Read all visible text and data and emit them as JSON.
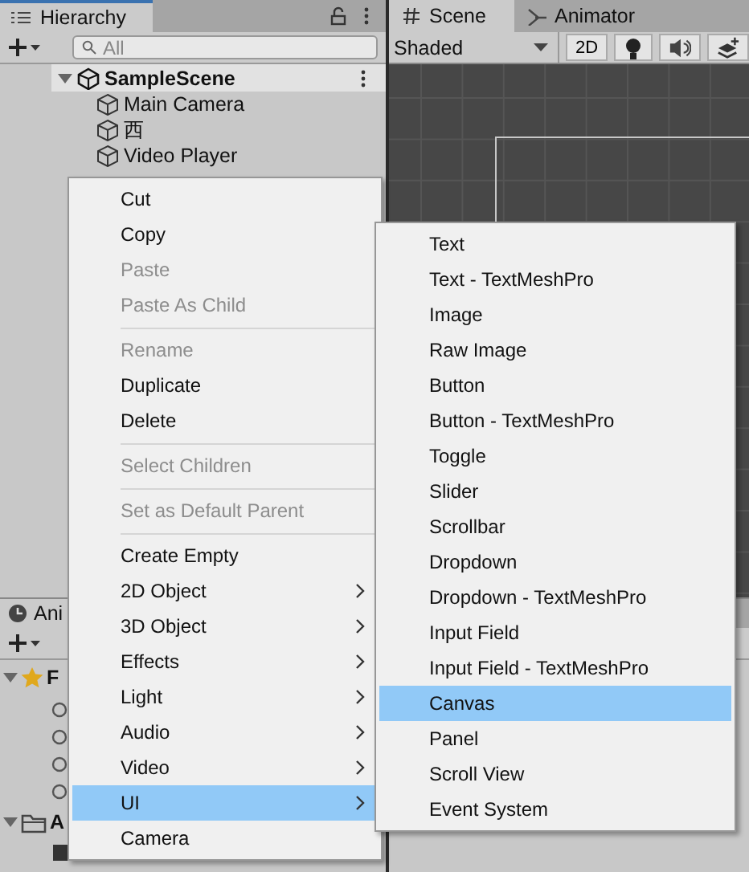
{
  "hierarchy": {
    "tab": "Hierarchy",
    "search": {
      "placeholder": "All"
    },
    "scene": {
      "name": "SampleScene",
      "expanded": true
    },
    "objects": [
      {
        "name": "Main Camera"
      },
      {
        "name": "西"
      },
      {
        "name": "Video Player"
      }
    ]
  },
  "scene_view": {
    "tabs": [
      {
        "label": "Scene",
        "selected": true,
        "kind": "grid"
      },
      {
        "label": "Animator",
        "selected": false,
        "kind": "animator"
      }
    ],
    "shading": "Shaded",
    "mode_2d": {
      "label": "2D",
      "on": false
    },
    "toggles": [
      {
        "kind": "lighting",
        "on": false
      },
      {
        "kind": "audio",
        "on": false
      },
      {
        "kind": "effects",
        "on": false
      }
    ]
  },
  "animation_panel": {
    "tab": "Ani",
    "tree": [
      {
        "label": "F",
        "kind": "favorites",
        "expanded": true
      },
      {
        "label": "A",
        "kind": "folder",
        "expanded": true
      }
    ]
  },
  "context_menu": {
    "items": [
      {
        "kind": "item",
        "label": "Cut",
        "disabled": false,
        "selected": false
      },
      {
        "kind": "item",
        "label": "Copy",
        "disabled": false,
        "selected": false
      },
      {
        "kind": "item",
        "label": "Paste",
        "disabled": true,
        "selected": false
      },
      {
        "kind": "item",
        "label": "Paste As Child",
        "disabled": true,
        "selected": false
      },
      {
        "kind": "separator"
      },
      {
        "kind": "item",
        "label": "Rename",
        "disabled": true,
        "selected": false
      },
      {
        "kind": "item",
        "label": "Duplicate",
        "disabled": false,
        "selected": false
      },
      {
        "kind": "item",
        "label": "Delete",
        "disabled": false,
        "selected": false
      },
      {
        "kind": "separator"
      },
      {
        "kind": "item",
        "label": "Select Children",
        "disabled": true,
        "selected": false
      },
      {
        "kind": "separator"
      },
      {
        "kind": "item",
        "label": "Set as Default Parent",
        "disabled": true,
        "selected": false
      },
      {
        "kind": "separator"
      },
      {
        "kind": "item",
        "label": "Create Empty",
        "disabled": false,
        "selected": false
      },
      {
        "kind": "submenu",
        "label": "2D Object",
        "disabled": false,
        "selected": false
      },
      {
        "kind": "submenu",
        "label": "3D Object",
        "disabled": false,
        "selected": false
      },
      {
        "kind": "submenu",
        "label": "Effects",
        "disabled": false,
        "selected": false
      },
      {
        "kind": "submenu",
        "label": "Light",
        "disabled": false,
        "selected": false
      },
      {
        "kind": "submenu",
        "label": "Audio",
        "disabled": false,
        "selected": false
      },
      {
        "kind": "submenu",
        "label": "Video",
        "disabled": false,
        "selected": false
      },
      {
        "kind": "submenu",
        "label": "UI",
        "disabled": false,
        "selected": true
      },
      {
        "kind": "item",
        "label": "Camera",
        "disabled": false,
        "selected": false
      }
    ]
  },
  "submenu": {
    "items": [
      {
        "kind": "item",
        "label": "Text",
        "disabled": false,
        "selected": false
      },
      {
        "kind": "item",
        "label": "Text - TextMeshPro",
        "disabled": false,
        "selected": false
      },
      {
        "kind": "item",
        "label": "Image",
        "disabled": false,
        "selected": false
      },
      {
        "kind": "item",
        "label": "Raw Image",
        "disabled": false,
        "selected": false
      },
      {
        "kind": "item",
        "label": "Button",
        "disabled": false,
        "selected": false
      },
      {
        "kind": "item",
        "label": "Button - TextMeshPro",
        "disabled": false,
        "selected": false
      },
      {
        "kind": "item",
        "label": "Toggle",
        "disabled": false,
        "selected": false
      },
      {
        "kind": "item",
        "label": "Slider",
        "disabled": false,
        "selected": false
      },
      {
        "kind": "item",
        "label": "Scrollbar",
        "disabled": false,
        "selected": false
      },
      {
        "kind": "item",
        "label": "Dropdown",
        "disabled": false,
        "selected": false
      },
      {
        "kind": "item",
        "label": "Dropdown - TextMeshPro",
        "disabled": false,
        "selected": false
      },
      {
        "kind": "item",
        "label": "Input Field",
        "disabled": false,
        "selected": false
      },
      {
        "kind": "item",
        "label": "Input Field - TextMeshPro",
        "disabled": false,
        "selected": false
      },
      {
        "kind": "item",
        "label": "Canvas",
        "disabled": false,
        "selected": true
      },
      {
        "kind": "item",
        "label": "Panel",
        "disabled": false,
        "selected": false
      },
      {
        "kind": "item",
        "label": "Scroll View",
        "disabled": false,
        "selected": false
      },
      {
        "kind": "item",
        "label": "Event System",
        "disabled": false,
        "selected": false
      }
    ]
  }
}
